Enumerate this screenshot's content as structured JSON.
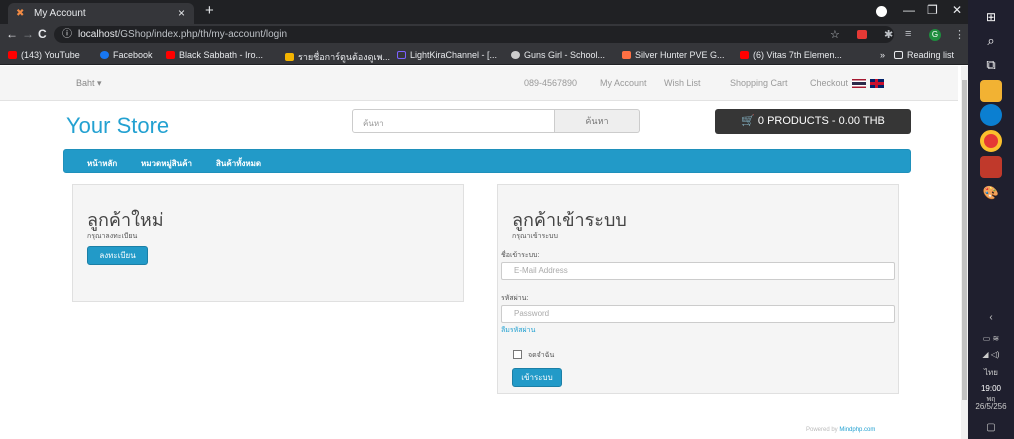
{
  "browser": {
    "tab_title": "My Account",
    "tab_close": "×",
    "new_tab": "+",
    "url_host": "localhost",
    "url_path": "/GShop/index.php/th/my-account/login",
    "window_controls": [
      "—",
      "❐",
      "✕"
    ],
    "nav": [
      "←",
      "→",
      "C"
    ],
    "bookmarks": [
      {
        "label": "(143) YouTube",
        "color": "#ff0000"
      },
      {
        "label": "Facebook",
        "color": "#1877f2"
      },
      {
        "label": "Black Sabbath - Iro...",
        "color": "#ff0000"
      },
      {
        "label": "รายชื่อการ์ตูนต้องดูเพ...",
        "color": "#f4b400"
      },
      {
        "label": "LightKiraChannel - [...",
        "color": "#7b61ff"
      },
      {
        "label": "Guns Girl - School...",
        "color": "#cccccc"
      },
      {
        "label": "Silver Hunter PVE G...",
        "color": "#ff7043"
      },
      {
        "label": "(6) Vitas 7th Elemen...",
        "color": "#ff0000"
      }
    ],
    "bookmarks_more": "»",
    "reading_list": "Reading list",
    "ext_badge": "G"
  },
  "store": {
    "currency": "Baht",
    "currency_caret": "▾",
    "phone": "089-4567890",
    "top_links": [
      "My Account",
      "Wish List",
      "Shopping Cart",
      "Checkout"
    ],
    "logo": "Your Store",
    "search_placeholder": "ค้นหา",
    "search_button": "ค้นหา",
    "cart": "0 PRODUCTS - 0.00 THB",
    "menu": [
      "หน้าหลัก",
      "หมวดหมู่สินค้า",
      "สินค้าทั้งหมด"
    ]
  },
  "new_customer": {
    "title": "ลูกค้าใหม่",
    "subtitle": "กรุณาลงทะเบียน",
    "button": "ลงทะเบียน"
  },
  "returning_customer": {
    "title": "ลูกค้าเข้าระบบ",
    "subtitle": "กรุณาเข้าระบบ",
    "username_label": "ชื่อเข้าระบบ:",
    "username_placeholder": "E-Mail Address",
    "password_label": "รหัสผ่าน:",
    "password_placeholder": "Password",
    "forgot": "ลืมรหัสผ่าน",
    "remember": "จดจำฉัน",
    "button": "เข้าระบบ"
  },
  "footer": {
    "powered_prefix": "Powered by",
    "powered_link": "Mindphp.com"
  },
  "taskbar": {
    "lang": "ไทย",
    "time": "19:00",
    "day": "พฤ",
    "date": "26/5/256"
  }
}
